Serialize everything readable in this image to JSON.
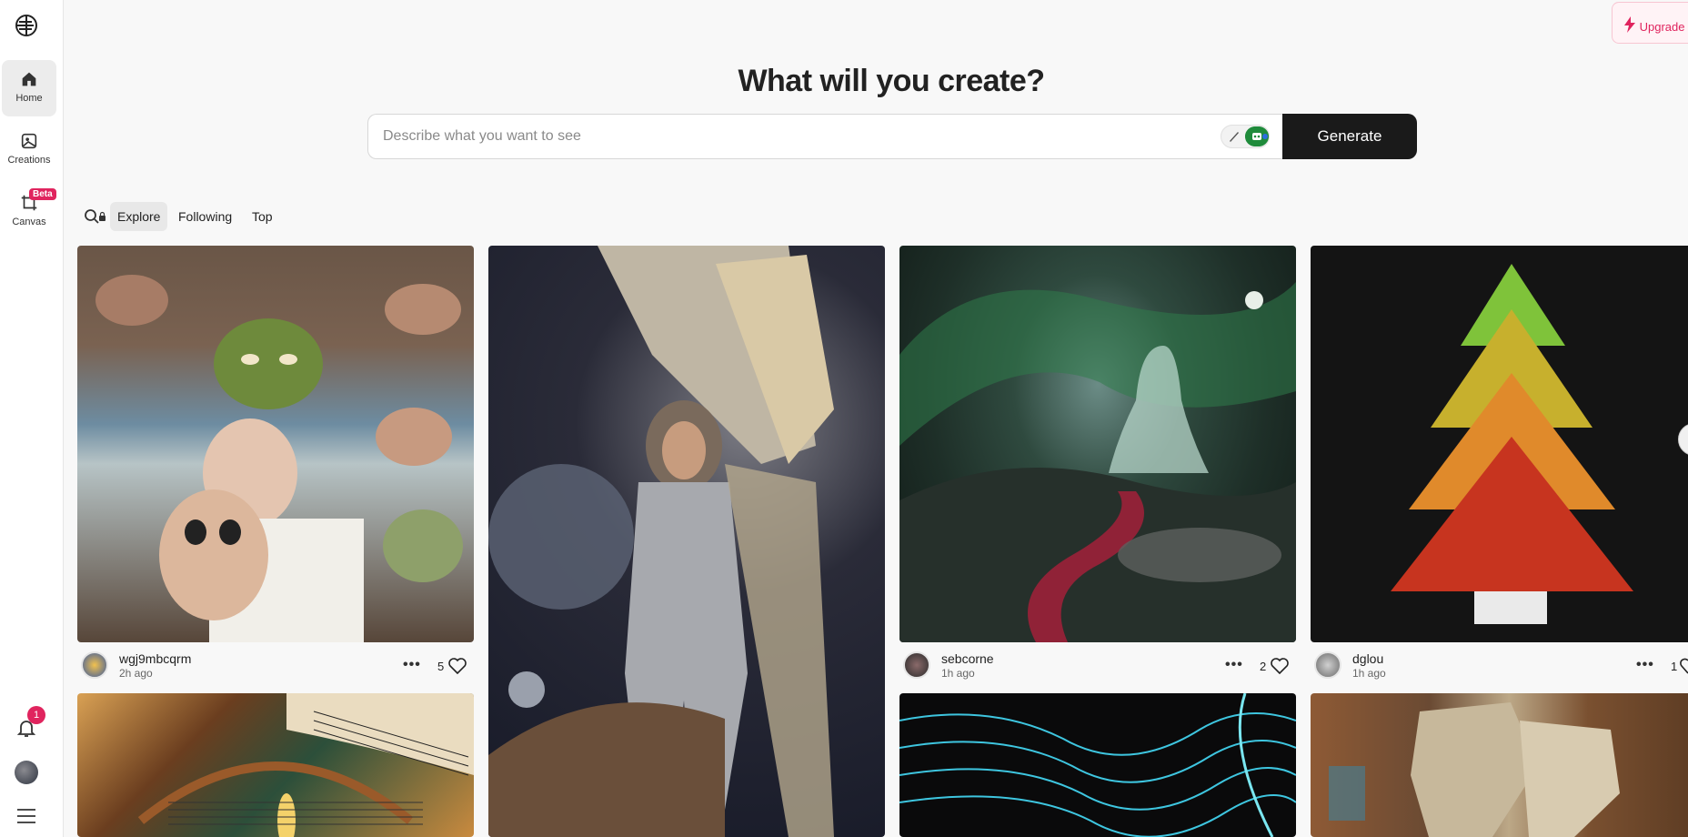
{
  "sidebar": {
    "items": [
      {
        "label": "Home",
        "icon": "home-icon",
        "active": true
      },
      {
        "label": "Creations",
        "icon": "image-icon",
        "active": false
      },
      {
        "label": "Canvas",
        "icon": "crop-icon",
        "active": false
      }
    ],
    "canvas_badge": "Beta",
    "notification_count": "1"
  },
  "header": {
    "upgrade_label": "Upgrade",
    "title": "What will you create?"
  },
  "prompt": {
    "placeholder": "Describe what you want to see",
    "generate_label": "Generate"
  },
  "filters": {
    "tabs": [
      {
        "label": "Explore",
        "active": true
      },
      {
        "label": "Following",
        "active": false
      },
      {
        "label": "Top",
        "active": false
      }
    ]
  },
  "feed": {
    "cards": [
      {
        "user": "wgj9mbcqrm",
        "time": "2h ago",
        "likes": "5"
      },
      {
        "user": "",
        "time": "",
        "likes": ""
      },
      {
        "user": "sebcorne",
        "time": "1h ago",
        "likes": "2"
      },
      {
        "user": "dglou",
        "time": "1h ago",
        "likes": "1"
      }
    ]
  },
  "colors": {
    "accent": "#e0245e",
    "generate_bg": "#1a1a1a"
  }
}
